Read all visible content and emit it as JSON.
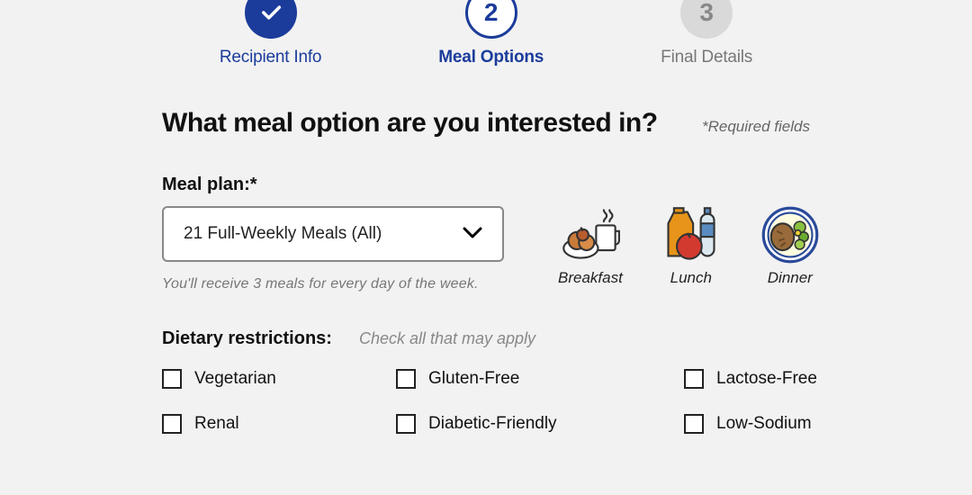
{
  "stepper": {
    "steps": [
      {
        "label": "Recipient Info"
      },
      {
        "label": "Meal Options"
      },
      {
        "label": "Final Details"
      }
    ]
  },
  "heading": "What meal option are you interested in?",
  "required_note": "*Required fields",
  "meal_plan": {
    "label": "Meal plan:*",
    "selected": "21 Full-Weekly Meals (All)",
    "helper": "You'll receive 3 meals for every day of the week."
  },
  "meal_types": [
    {
      "label": "Breakfast"
    },
    {
      "label": "Lunch"
    },
    {
      "label": "Dinner"
    }
  ],
  "dietary": {
    "label": "Dietary restrictions:",
    "note": "Check all that may apply",
    "options": [
      "Vegetarian",
      "Gluten-Free",
      "Lactose-Free",
      "Renal",
      "Diabetic-Friendly",
      "Low-Sodium"
    ]
  }
}
